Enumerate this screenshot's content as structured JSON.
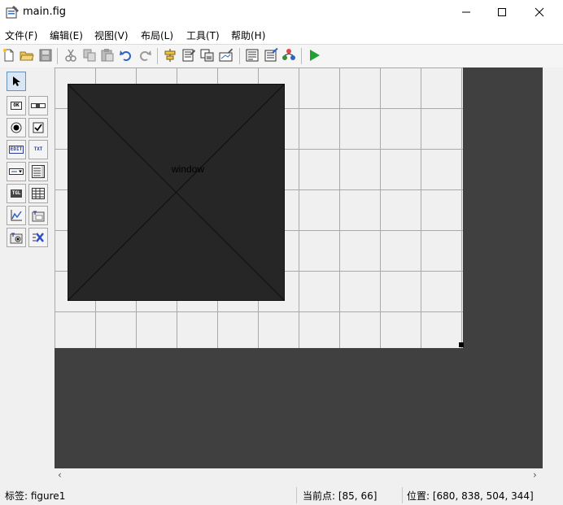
{
  "window": {
    "title": "main.fig"
  },
  "menu": [
    "文件(F)",
    "编辑(E)",
    "视图(V)",
    "布局(L)",
    "工具(T)",
    "帮助(H)"
  ],
  "toolbar_icons": [
    "new-file-icon",
    "open-folder-icon",
    "save-icon",
    "cut-icon",
    "copy-icon",
    "paste-icon",
    "undo-icon",
    "redo-icon",
    "align-objects-icon",
    "menu-editor-icon",
    "tab-order-icon",
    "toolbar-editor-icon",
    "editor-icon",
    "property-inspector-icon",
    "object-browser-icon",
    "run-icon"
  ],
  "palette": {
    "tools": [
      {
        "name": "select-tool",
        "label": ""
      },
      {
        "name": "push-button-tool",
        "label": "OK"
      },
      {
        "name": "slider-tool",
        "label": ""
      },
      {
        "name": "radio-button-tool",
        "label": ""
      },
      {
        "name": "checkbox-tool",
        "label": ""
      },
      {
        "name": "edit-text-tool",
        "label": "EDIT"
      },
      {
        "name": "static-text-tool",
        "label": "TXT"
      },
      {
        "name": "popup-menu-tool",
        "label": ""
      },
      {
        "name": "listbox-tool",
        "label": ""
      },
      {
        "name": "toggle-button-tool",
        "label": "TGL"
      },
      {
        "name": "table-tool",
        "label": ""
      },
      {
        "name": "axes-tool",
        "label": ""
      },
      {
        "name": "panel-tool",
        "label": ""
      },
      {
        "name": "button-group-tool",
        "label": ""
      },
      {
        "name": "activex-tool",
        "label": ""
      }
    ]
  },
  "canvas": {
    "axes_label": "window",
    "figure_color": "#f0f0f0",
    "background_color": "#404040",
    "axes_color": "#262626"
  },
  "status": {
    "tag": "标签: figure1",
    "current_point": "当前点:  [85, 66]",
    "position": "位置: [680, 838, 504, 344]"
  }
}
